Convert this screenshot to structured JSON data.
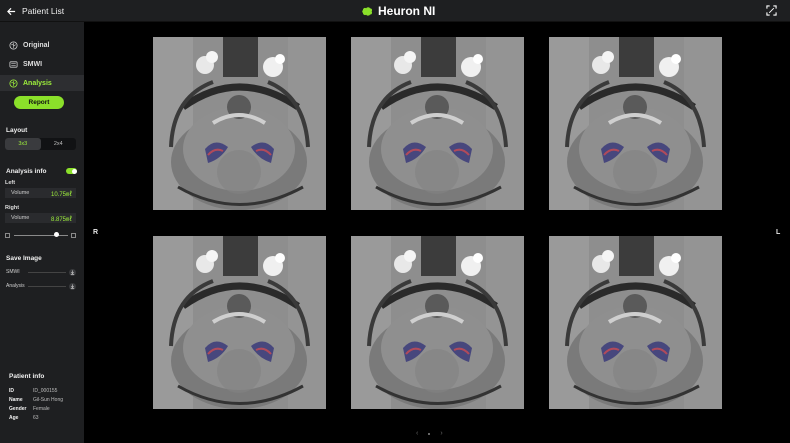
{
  "header": {
    "back_label": "Patient List",
    "brand_name": "Heuron NI"
  },
  "nav": [
    {
      "label": "Original",
      "icon": "brain-icon",
      "active": false
    },
    {
      "label": "SMWI",
      "icon": "layers-icon",
      "active": false
    },
    {
      "label": "Analysis",
      "icon": "analysis-brain-icon",
      "active": true
    }
  ],
  "report_label": "Report",
  "layout": {
    "title": "Layout",
    "options": [
      "3x3",
      "2x4"
    ],
    "selected": "3x3"
  },
  "analysis_info": {
    "title": "Analysis info",
    "enabled": true,
    "left": {
      "label": "Left",
      "key": "Volume",
      "value": "10.75㎖"
    },
    "right": {
      "label": "Right",
      "key": "Volume",
      "value": "8.875㎖"
    },
    "slider_level": 0.78
  },
  "save_image": {
    "title": "Save Image",
    "items": [
      "SMWI",
      "Analysis"
    ]
  },
  "patient_info": {
    "title": "Patient info",
    "rows": [
      {
        "key": "ID",
        "value": "ID_000155"
      },
      {
        "key": "Name",
        "value": "Gil-Sun Hong"
      },
      {
        "key": "Gender",
        "value": "Female"
      },
      {
        "key": "Age",
        "value": "63"
      }
    ]
  },
  "viewer": {
    "orientation_left": "R",
    "orientation_right": "L",
    "pager_prev": "‹",
    "pager_next": "›",
    "image_count": 6
  },
  "colors": {
    "accent": "#8be02a",
    "panel": "#1e1f21",
    "background": "#000000"
  }
}
